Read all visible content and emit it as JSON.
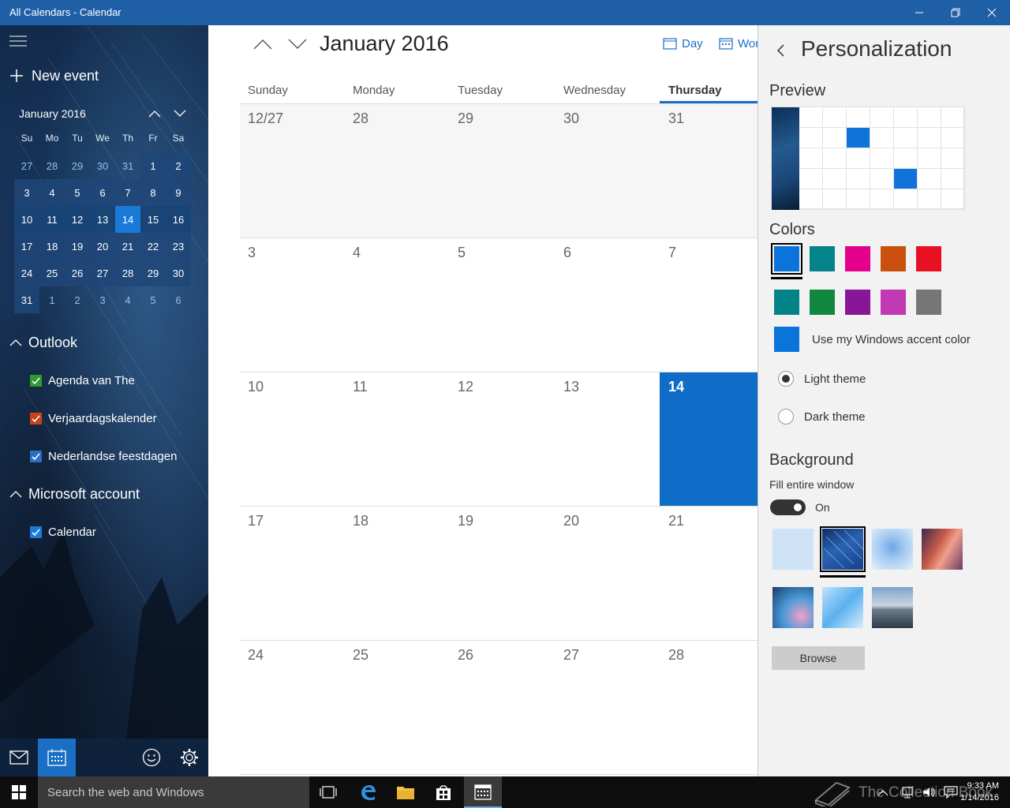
{
  "window": {
    "title": "All Calendars - Calendar"
  },
  "sidebar": {
    "new_event_label": "New event",
    "mini_calendar": {
      "title": "January 2016",
      "dow": [
        "Su",
        "Mo",
        "Tu",
        "We",
        "Th",
        "Fr",
        "Sa"
      ],
      "days": [
        "27",
        "28",
        "29",
        "30",
        "31",
        "1",
        "2",
        "3",
        "4",
        "5",
        "6",
        "7",
        "8",
        "9",
        "10",
        "11",
        "12",
        "13",
        "14",
        "15",
        "16",
        "17",
        "18",
        "19",
        "20",
        "21",
        "22",
        "23",
        "24",
        "25",
        "26",
        "27",
        "28",
        "29",
        "30",
        "31",
        "1",
        "2",
        "3",
        "4",
        "5",
        "6"
      ],
      "today": "14"
    },
    "groups": [
      {
        "name": "Outlook",
        "calendars": [
          {
            "name": "Agenda van The",
            "color": "#2e9b2e",
            "checked": true
          },
          {
            "name": "Verjaardagskalender",
            "color": "#c8421c",
            "checked": true
          },
          {
            "name": "Nederlandse feestdagen",
            "color": "#2a6fc4",
            "checked": true
          }
        ]
      },
      {
        "name": "Microsoft account",
        "calendars": [
          {
            "name": "Calendar",
            "color": "#1a7ad8",
            "checked": true
          }
        ]
      }
    ]
  },
  "main": {
    "month_title": "January 2016",
    "views": {
      "day": "Day",
      "work_week": "Wor"
    },
    "dow": [
      "Sunday",
      "Monday",
      "Tuesday",
      "Wednesday",
      "Thursday"
    ],
    "weeks": [
      [
        "12/27",
        "28",
        "29",
        "30",
        "31"
      ],
      [
        "3",
        "4",
        "5",
        "6",
        "7"
      ],
      [
        "10",
        "11",
        "12",
        "13",
        "14"
      ],
      [
        "17",
        "18",
        "19",
        "20",
        "21"
      ],
      [
        "24",
        "25",
        "26",
        "27",
        "28"
      ]
    ],
    "today": "14",
    "accent": "#0f6cc7"
  },
  "personalization": {
    "title": "Personalization",
    "preview_heading": "Preview",
    "colors_heading": "Colors",
    "colors": [
      "#0a74da",
      "#03838c",
      "#e3008c",
      "#ca5010",
      "#e81123",
      "#038387",
      "#10893e",
      "#881798",
      "#c239b3",
      "#767676"
    ],
    "selected_color": "#0a74da",
    "accent_color_label": "Use my Windows accent color",
    "light_theme_label": "Light theme",
    "dark_theme_label": "Dark theme",
    "selected_theme": "Light theme",
    "background_heading": "Background",
    "fill_label": "Fill entire window",
    "toggle_label": "On",
    "browse_label": "Browse"
  },
  "taskbar": {
    "search_placeholder": "Search the web and Windows",
    "time": "9:33 AM",
    "date": "1/14/2016",
    "watermark": "The Collection Book"
  }
}
